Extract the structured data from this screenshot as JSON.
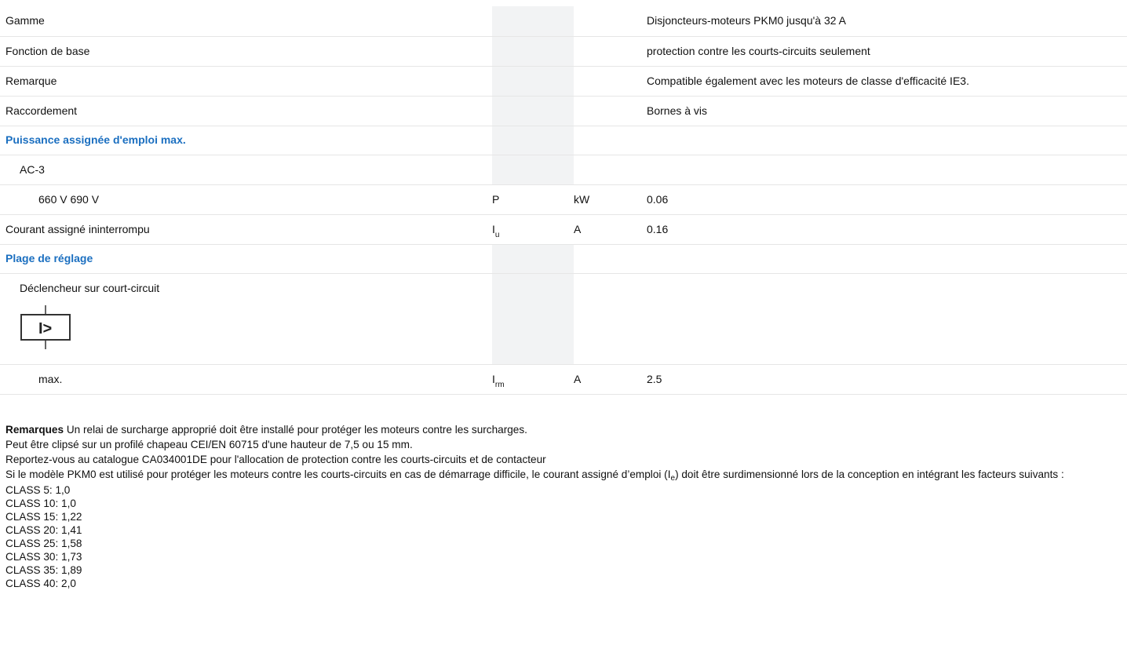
{
  "rows": {
    "gamme": {
      "label": "Gamme",
      "value": "Disjoncteurs-moteurs PKM0 jusqu'à 32 A"
    },
    "fonction": {
      "label": "Fonction de base",
      "value": "protection contre les courts-circuits seulement"
    },
    "remarque": {
      "label": "Remarque",
      "value": "Compatible également avec les moteurs de classe d'efficacité IE3."
    },
    "raccordement": {
      "label": "Raccordement",
      "value": "Bornes à vis"
    },
    "puissance_heading": "Puissance assignée d'emploi max.",
    "ac3": "AC-3",
    "tension": {
      "label": "660 V 690 V",
      "symbol": "P",
      "unit": "kW",
      "value": "0.06"
    },
    "courant": {
      "label": "Courant assigné ininterrompu",
      "symbol": "I",
      "symbol_sub": "u",
      "unit": "A",
      "value": "0.16"
    },
    "plage_heading": "Plage de réglage",
    "declencheur": {
      "label": "Déclencheur sur court-circuit",
      "icon": "short-circuit-release-symbol-icon",
      "icon_text": "I>"
    },
    "max": {
      "label": "max.",
      "symbol": "I",
      "symbol_sub": "rm",
      "unit": "A",
      "value": "2.5"
    }
  },
  "notes": {
    "remarques_label": "Remarques",
    "line1": " Un relai de surcharge approprié doit être installé pour protéger les moteurs contre les surcharges.",
    "line2": "Peut être clipsé sur un profilé chapeau CEI/EN 60715 d'une hauteur de 7,5 ou 15 mm.",
    "line3": "Reportez-vous au catalogue CA034001DE pour l'allocation de protection contre les courts-circuits et de contacteur",
    "line4_a": "Si le modèle PKM0 est utilisé pour protéger les moteurs contre les courts-circuits en cas de démarrage difficile, le courant assigné d’emploi (I",
    "line4_sub": "e",
    "line4_b": ") doit être surdimensionné lors de la conception en intégrant les facteurs suivants :",
    "classes": [
      "CLASS 5: 1,0",
      "CLASS 10: 1,0",
      "CLASS 15: 1,22",
      "CLASS 20: 1,41",
      "CLASS 25: 1,58",
      "CLASS 30: 1,73",
      "CLASS 35: 1,89",
      "CLASS 40: 2,0"
    ]
  }
}
